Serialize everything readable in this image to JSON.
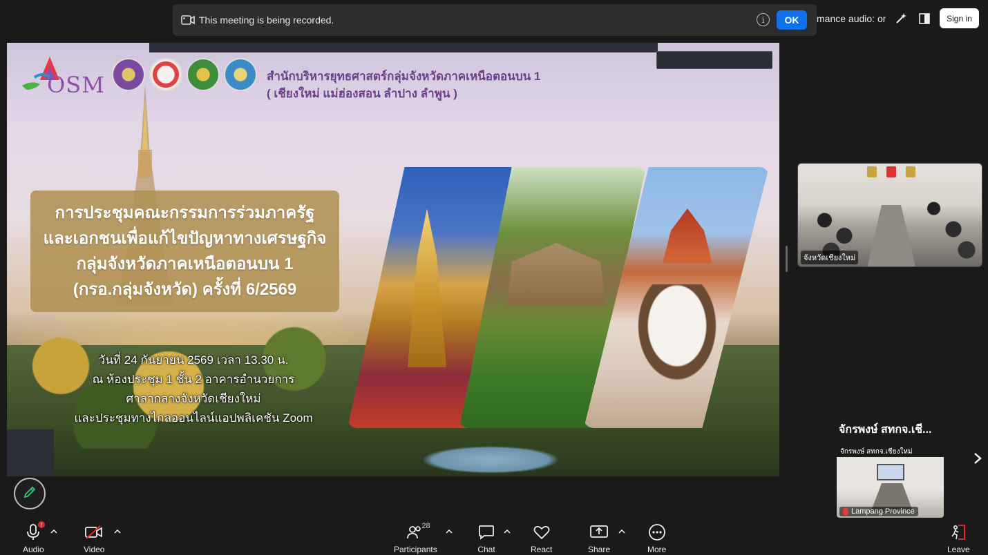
{
  "banner": {
    "message": "This meeting is being recorded.",
    "ok_label": "OK"
  },
  "top_right": {
    "audio_status": "mance audio: on",
    "sign_in_label": "Sign in"
  },
  "slide": {
    "osm_text": "OSM",
    "office_line1": "สำนักบริหารยุทธศาสตร์กลุ่มจังหวัดภาคเหนือตอนบน 1",
    "office_line2": "( เชียงใหม่ แม่ฮ่องสอน ลำปาง ลำพูน )",
    "title_lines": [
      "การประชุมคณะกรรมการร่วมภาครัฐ",
      "และเอกชนเพื่อแก้ไขปัญหาทางเศรษฐกิจ",
      "กลุ่มจังหวัดภาคเหนือตอนบน 1",
      "(กรอ.กลุ่มจังหวัด) ครั้งที่ 6/2569"
    ],
    "details": [
      "วันที่ 24 กันยายน 2569 เวลา 13.30 น.",
      "ณ ห้องประชุม 1 ชั้น 2 อาคารอำนวยการ",
      "ศาลากลางจังหวัดเชียงใหม่",
      "และประชุมทางไกลออนไลน์แอปพลิเคชัน Zoom"
    ]
  },
  "right_panel": {
    "video_tile_label": "จังหวัดเชียงใหม่",
    "speaker_name": "จักรพงษ์ สทกจ.เชี...",
    "thumb_top_name": "จักรพงษ์ สทกจ.เชียงใหม่",
    "thumb_label": "Lampang Province"
  },
  "toolbar": {
    "audio": "Audio",
    "video": "Video",
    "participants": "Participants",
    "participants_count": "28",
    "chat": "Chat",
    "react": "React",
    "share": "Share",
    "more": "More",
    "leave": "Leave"
  },
  "colors": {
    "ok_blue": "#0e71eb",
    "leave_red": "#e02828",
    "title_box": "#b09153",
    "office_purple": "#6b3f8a"
  }
}
